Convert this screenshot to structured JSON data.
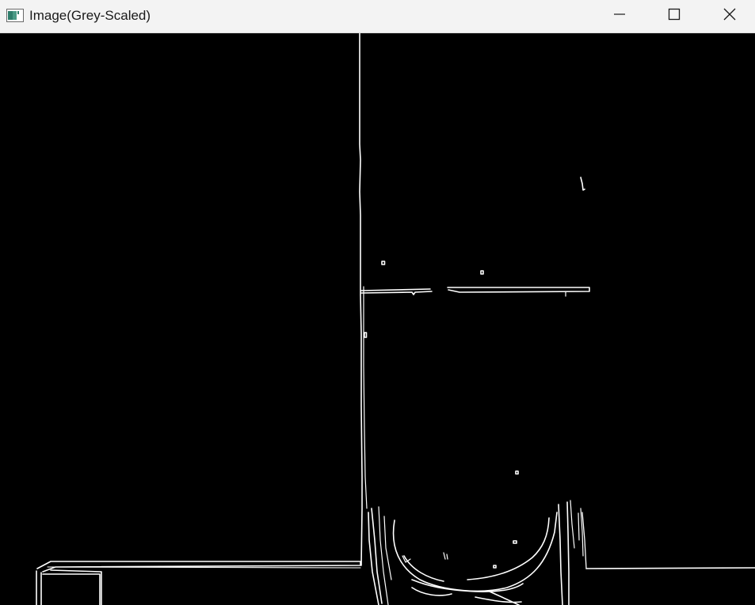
{
  "window": {
    "title": "Image(Grey-Scaled)",
    "icon": "opencv-window-icon",
    "controls": {
      "minimize": "minimize-icon",
      "maximize": "maximize-icon",
      "close": "close-icon"
    }
  },
  "canvas": {
    "content": "edge-detected-image",
    "background_color": "#000000",
    "edge_color": "#ffffff"
  }
}
